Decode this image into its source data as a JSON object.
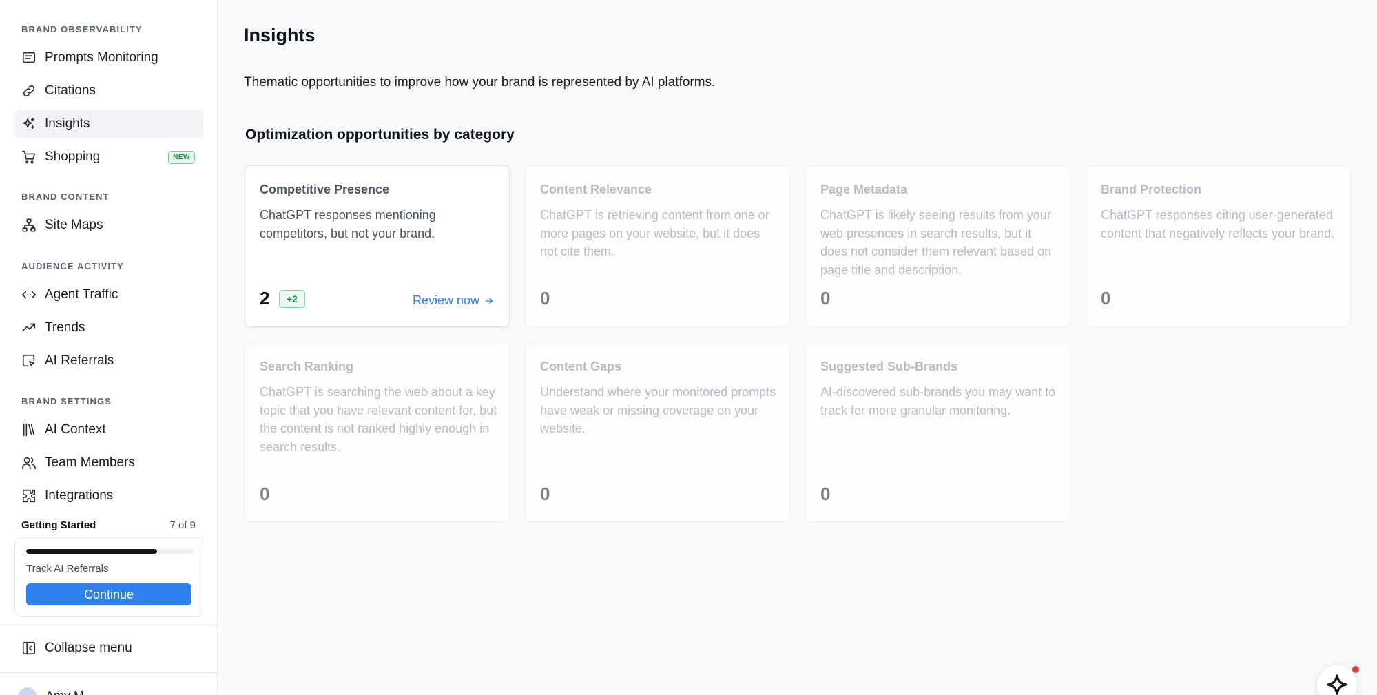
{
  "sidebar": {
    "sections": {
      "observability": "BRAND OBSERVABILITY",
      "content": "BRAND CONTENT",
      "audience": "AUDIENCE ACTIVITY",
      "settings": "BRAND SETTINGS"
    },
    "items": {
      "prompts_monitoring": "Prompts Monitoring",
      "citations": "Citations",
      "insights": "Insights",
      "shopping": "Shopping",
      "shopping_badge": "NEW",
      "site_maps": "Site Maps",
      "agent_traffic": "Agent Traffic",
      "trends": "Trends",
      "ai_referrals": "AI Referrals",
      "ai_context": "AI Context",
      "team_members": "Team Members",
      "integrations": "Integrations"
    },
    "active_item": "Insights",
    "getting_started": {
      "title": "Getting Started",
      "count": "7 of 9",
      "progress": 0.78,
      "task": "Track AI Referrals",
      "button": "Continue"
    },
    "collapse_label": "Collapse menu",
    "user_name": "Amy M"
  },
  "main": {
    "title": "Insights",
    "description": "Thematic opportunities to improve how your brand is represented by AI platforms.",
    "section_title": "Optimization opportunities by category",
    "cards": [
      {
        "title": "Competitive Presence",
        "description": "ChatGPT responses mentioning competitors, but not your brand.",
        "count": "2",
        "delta": "+2",
        "link": "Review now"
      },
      {
        "title": "Content Relevance",
        "description": "ChatGPT is retrieving content from one or more pages on your website, but it does not cite them.",
        "count": "0"
      },
      {
        "title": "Page Metadata",
        "description": "ChatGPT is likely seeing results from your web presences in search results, but it does not consider them relevant based on page title and description.",
        "count": "0"
      },
      {
        "title": "Brand Protection",
        "description": "ChatGPT responses citing user-generated content that negatively reflects your brand.",
        "count": "0"
      },
      {
        "title": "Search Ranking",
        "description": "ChatGPT is searching the web about a key topic that you have relevant content for, but the content is not ranked highly enough in search results.",
        "count": "0"
      },
      {
        "title": "Content Gaps",
        "description": "Understand where your monitored prompts have weak or missing coverage on your website.",
        "count": "0"
      },
      {
        "title": "Suggested Sub-Brands",
        "description": "AI-discovered sub-brands you may want to track for more granular monitoring.",
        "count": "0"
      }
    ]
  },
  "colors": {
    "accent": "#2f80ed",
    "success": "#1f8f4c",
    "notification": "#e53935"
  }
}
